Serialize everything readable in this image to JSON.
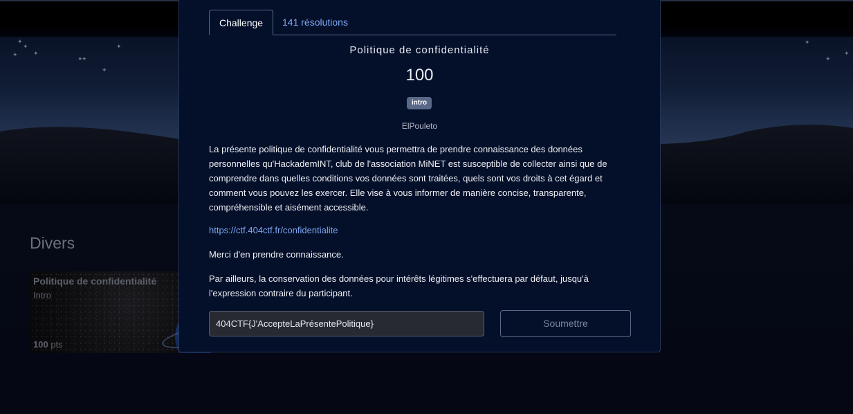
{
  "modal": {
    "tabs": [
      {
        "label": "Challenge"
      },
      {
        "label": "141 résolutions"
      }
    ],
    "close_icon": "close-icon",
    "title": "Politique de confidentialité",
    "value": "100",
    "tag": "intro",
    "author": "ElPouleto",
    "paragraph1": "La présente politique de confidentialité vous permettra de prendre connaissance des données personnelles qu'HackademINT, club de l'association MiNET est susceptible de collecter ainsi que de comprendre dans quelles conditions vos données sont traitées, quels sont vos droits à cet égard et comment vous pouvez les exercer. Elle vise à vous informer de manière concise, transparente, compréhensible et aisément accessible.",
    "link": "https://ctf.404ctf.fr/confidentialite",
    "paragraph2": "Merci d'en prendre connaissance.",
    "paragraph3": "Par ailleurs, la conservation des données pour intérêts légitimes s'effectuera par défaut, jusqu'à l'expression contraire du participant.",
    "flag_value": "404CTF{J'AccepteLaPrésentePolitique}",
    "submit_label": "Soumettre"
  },
  "background": {
    "section_title": "Divers",
    "card": {
      "title": "Politique de confidentialité",
      "subtitle": "Intro",
      "points": "100",
      "points_unit": "pts"
    }
  },
  "colors": {
    "modal_bg": "#04102a",
    "link": "#7ea6f0",
    "tag_bg": "#5a6888"
  }
}
